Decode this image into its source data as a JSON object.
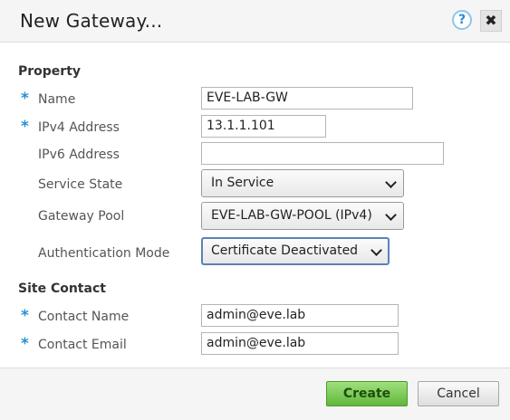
{
  "dialog": {
    "title": "New Gateway...",
    "help_icon": "?",
    "close_icon": "✖"
  },
  "property_section": {
    "title": "Property",
    "required_marker": "*",
    "fields": {
      "name": {
        "label": "Name",
        "value": "EVE-LAB-GW",
        "required": true
      },
      "ipv4": {
        "label": "IPv4 Address",
        "value": "13.1.1.101",
        "required": true
      },
      "ipv6": {
        "label": "IPv6 Address",
        "value": "",
        "required": false
      },
      "service_state": {
        "label": "Service State",
        "value": "In Service"
      },
      "gateway_pool": {
        "label": "Gateway Pool",
        "value": "EVE-LAB-GW-POOL (IPv4)"
      },
      "auth_mode": {
        "label": "Authentication Mode",
        "value": "Certificate Deactivated"
      }
    }
  },
  "site_contact_section": {
    "title": "Site Contact",
    "fields": {
      "contact_name": {
        "label": "Contact Name",
        "value": "admin@eve.lab",
        "required": true
      },
      "contact_email": {
        "label": "Contact Email",
        "value": "admin@eve.lab",
        "required": true
      }
    }
  },
  "footer": {
    "create_label": "Create",
    "cancel_label": "Cancel"
  },
  "colors": {
    "accent_required": "#2a8dd4",
    "create_button": "#61b73d",
    "focus_border": "#5a83b8"
  },
  "icons": {
    "help": "help-icon",
    "close": "close-icon",
    "dropdown": "chevron-down-icon",
    "required": "asterisk-icon"
  }
}
